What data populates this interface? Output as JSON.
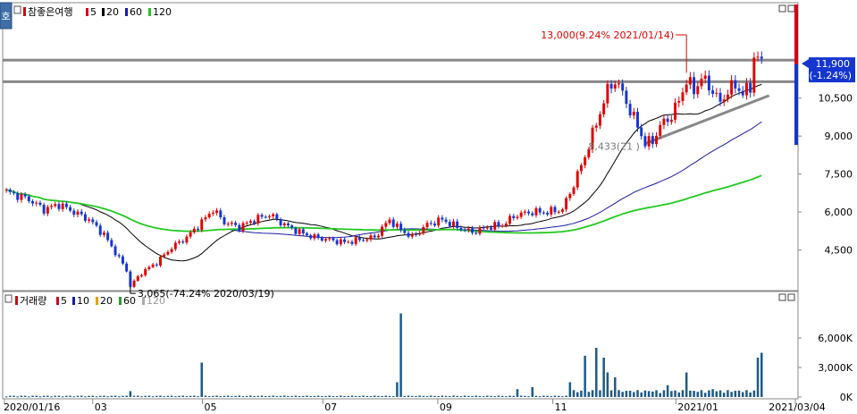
{
  "header": {
    "mode_label": "호",
    "price_pane": {
      "stock_name": "참좋은여행",
      "ma_legend": [
        {
          "label": "5",
          "color": "#d4001a"
        },
        {
          "label": "20",
          "color": "#000000"
        },
        {
          "label": "60",
          "color": "#1a1aa6"
        },
        {
          "label": "120",
          "color": "#22c822"
        }
      ]
    },
    "volume_pane": {
      "title": "거래량",
      "ma_legend": [
        {
          "label": "5",
          "color": "#d4001a"
        },
        {
          "label": "10",
          "color": "#1a1aa6"
        },
        {
          "label": "20",
          "color": "#e8a000"
        },
        {
          "label": "60",
          "color": "#2a9a2a"
        },
        {
          "label": "120",
          "color": "#aaaaaa"
        }
      ]
    }
  },
  "chart_data": [
    {
      "type": "candlestick",
      "title": "참좋은여행",
      "x_ticks": [
        "2020/01/16",
        "03",
        "05",
        "07",
        "09",
        "11",
        "2021/01",
        "2021/03/04"
      ],
      "y_ticks": [
        "10,500",
        "9,000",
        "7,500",
        "6,000",
        "4,500"
      ],
      "ylim": [
        3000,
        13600
      ],
      "price_path": [
        [
          0,
          6800
        ],
        [
          6,
          6500
        ],
        [
          10,
          6100
        ],
        [
          14,
          6300
        ],
        [
          18,
          6000
        ],
        [
          22,
          5700
        ],
        [
          26,
          5100
        ],
        [
          29,
          4400
        ],
        [
          32,
          3700
        ],
        [
          33,
          3065
        ],
        [
          36,
          3600
        ],
        [
          40,
          4000
        ],
        [
          44,
          4600
        ],
        [
          48,
          5000
        ],
        [
          52,
          5600
        ],
        [
          55,
          6100
        ],
        [
          58,
          5600
        ],
        [
          62,
          5400
        ],
        [
          66,
          5700
        ],
        [
          70,
          5900
        ],
        [
          74,
          5500
        ],
        [
          78,
          5200
        ],
        [
          82,
          5000
        ],
        [
          86,
          4900
        ],
        [
          90,
          4800
        ],
        [
          94,
          4900
        ],
        [
          98,
          5000
        ],
        [
          102,
          5700
        ],
        [
          104,
          5400
        ],
        [
          108,
          5000
        ],
        [
          112,
          5500
        ],
        [
          116,
          5700
        ],
        [
          120,
          5400
        ],
        [
          124,
          5200
        ],
        [
          128,
          5400
        ],
        [
          132,
          5500
        ],
        [
          136,
          5900
        ],
        [
          140,
          6000
        ],
        [
          144,
          6000
        ],
        [
          148,
          6100
        ],
        [
          151,
          7100
        ],
        [
          154,
          8200
        ],
        [
          157,
          9500
        ],
        [
          160,
          10800
        ],
        [
          162,
          11200
        ],
        [
          164,
          10700
        ],
        [
          166,
          10000
        ],
        [
          168,
          9400
        ],
        [
          170,
          8700
        ],
        [
          172,
          8800
        ],
        [
          174,
          9400
        ],
        [
          177,
          9800
        ],
        [
          179,
          10400
        ],
        [
          181,
          11200
        ],
        [
          183,
          10800
        ],
        [
          185,
          11300
        ],
        [
          188,
          10800
        ],
        [
          190,
          10300
        ],
        [
          192,
          10800
        ],
        [
          194,
          11000
        ],
        [
          196,
          10700
        ],
        [
          198,
          10900
        ],
        [
          199,
          12200
        ],
        [
          201,
          11900
        ]
      ],
      "max_annotation": {
        "label": "13,000(9.24% 2021/01/14)",
        "value": 13000
      },
      "min_annotation": {
        "label": "3,065(-74.24% 2020/03/19)",
        "value": 3065
      },
      "swing_annotation": {
        "label": "8,433(21 )",
        "value": 8600
      },
      "current_price": {
        "value": 11900,
        "label": "11,900",
        "change": "(-1.24%)"
      },
      "horizontal_lines": [
        12000,
        11150
      ],
      "trendline": {
        "from": [
          170,
          8700
        ],
        "to": [
          203,
          10600
        ]
      },
      "moving_averages": [
        {
          "name": "20",
          "color": "#000000",
          "period": 20
        },
        {
          "name": "60",
          "color": "#1a1aa6",
          "period": 60
        },
        {
          "name": "120",
          "color": "#22c822",
          "period": 120
        }
      ]
    },
    {
      "type": "bar",
      "title": "거래량",
      "y_ticks": [
        "6,000K",
        "3,000K",
        "0K"
      ],
      "ylim": [
        0,
        9000
      ],
      "spikes": [
        {
          "i": 33,
          "v": 600
        },
        {
          "i": 52,
          "v": 3500
        },
        {
          "i": 105,
          "v": 8500
        },
        {
          "i": 104,
          "v": 1500
        },
        {
          "i": 154,
          "v": 4200
        },
        {
          "i": 157,
          "v": 5000
        },
        {
          "i": 159,
          "v": 4000
        },
        {
          "i": 160,
          "v": 2500
        },
        {
          "i": 162,
          "v": 2000
        },
        {
          "i": 181,
          "v": 2500
        },
        {
          "i": 200,
          "v": 4000
        },
        {
          "i": 201,
          "v": 4500
        },
        {
          "i": 136,
          "v": 800
        },
        {
          "i": 140,
          "v": 1000
        },
        {
          "i": 150,
          "v": 1500
        },
        {
          "i": 176,
          "v": 1200
        },
        {
          "i": 188,
          "v": 800
        }
      ]
    }
  ]
}
